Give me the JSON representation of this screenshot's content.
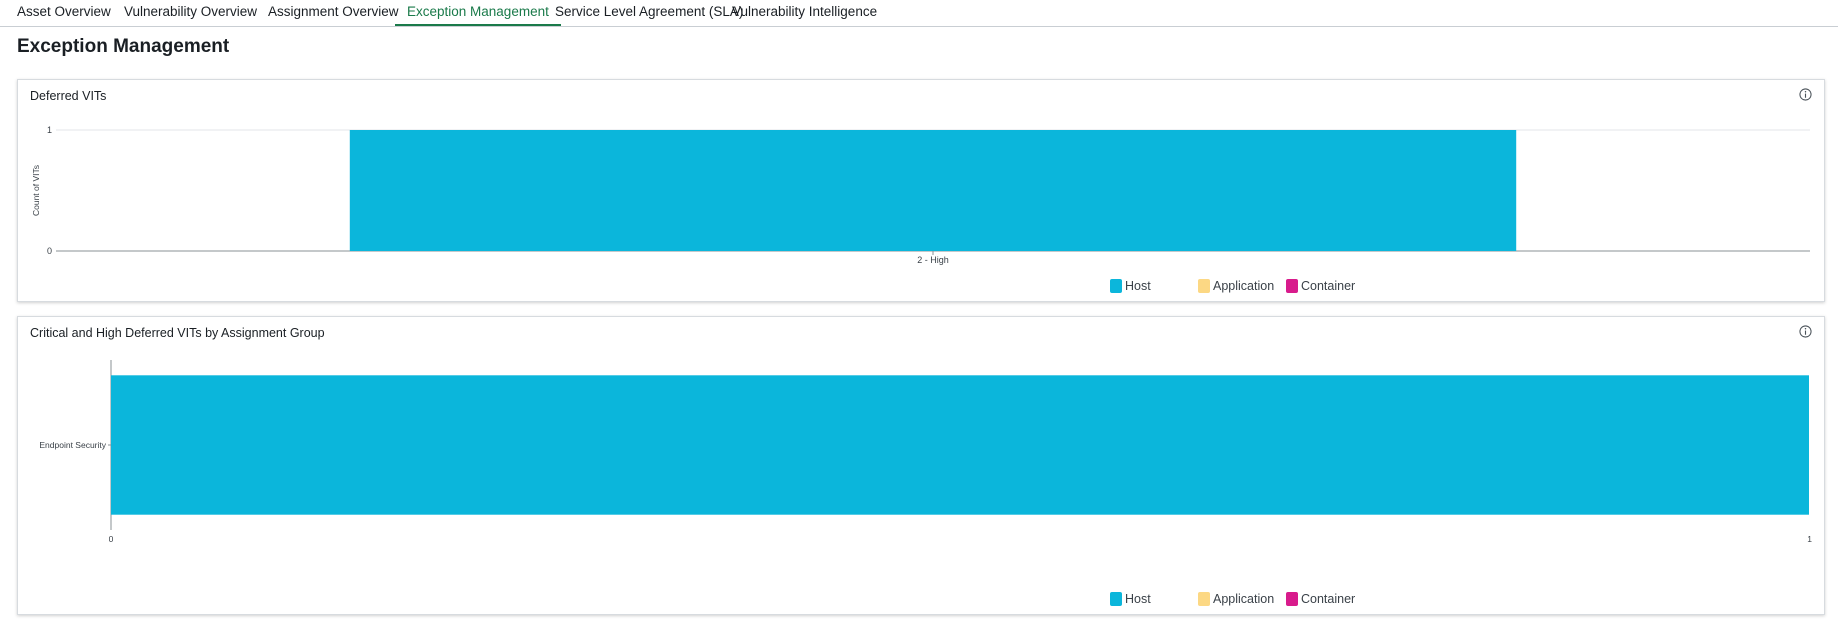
{
  "tabs": [
    {
      "label": "Asset Overview",
      "active": false
    },
    {
      "label": "Vulnerability Overview",
      "active": false
    },
    {
      "label": "Assignment Overview",
      "active": false
    },
    {
      "label": "Exception Management",
      "active": true
    },
    {
      "label": "Service Level Agreement (SLA)",
      "active": false
    },
    {
      "label": "Vulnerability Intelligence",
      "active": false
    }
  ],
  "page_title": "Exception Management",
  "colors": {
    "accent": "#1a7a4a",
    "host": "#0bb6db",
    "application": "#fcd884",
    "container": "#d81b8c"
  },
  "legend": [
    {
      "label": "Host",
      "icon": "host-swatch"
    },
    {
      "label": "Application",
      "icon": "application-swatch"
    },
    {
      "label": "Container",
      "icon": "container-swatch"
    }
  ],
  "chart_data": [
    {
      "title": "Deferred VITs",
      "type": "bar",
      "orientation": "vertical",
      "categories": [
        "2 - High"
      ],
      "series": [
        {
          "name": "Host",
          "values": [
            1
          ]
        },
        {
          "name": "Application",
          "values": [
            0
          ]
        },
        {
          "name": "Container",
          "values": [
            0
          ]
        }
      ],
      "ylabel": "Count of VITs",
      "xlabel": "",
      "yticks": [
        0,
        1
      ],
      "ylim": [
        0,
        1
      ],
      "grid": true,
      "legend_position": "bottom-center"
    },
    {
      "title": "Critical and High Deferred VITs by Assignment Group",
      "type": "bar",
      "orientation": "horizontal",
      "categories": [
        "Endpoint Security"
      ],
      "series": [
        {
          "name": "Host",
          "values": [
            1
          ]
        },
        {
          "name": "Application",
          "values": [
            0
          ]
        },
        {
          "name": "Container",
          "values": [
            0
          ]
        }
      ],
      "xticks": [
        0,
        1
      ],
      "xlim": [
        0,
        1
      ],
      "grid": false,
      "legend_position": "bottom-center"
    }
  ]
}
